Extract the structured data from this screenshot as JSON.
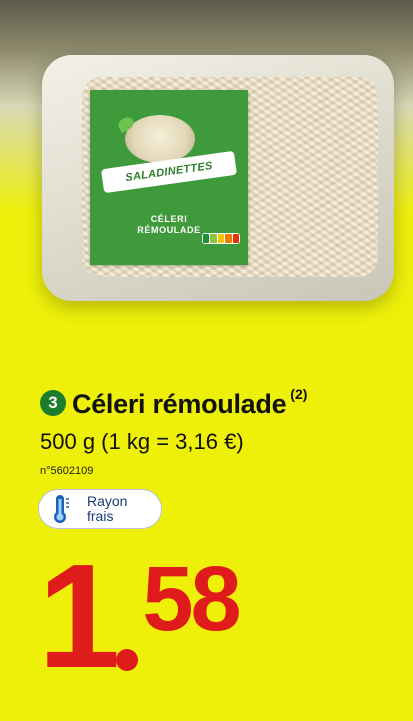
{
  "product": {
    "number": "3",
    "name": "Céleri rémoulade",
    "footnote": "(2)",
    "weight": "500 g (1 kg = 3,16 €)",
    "ref": "n°5602109"
  },
  "badge": {
    "line1": "Rayon",
    "line2": "frais",
    "icon": "thermometer-icon"
  },
  "package": {
    "brand": "SALADINETTES",
    "label_line1": "CÉLERI",
    "label_line2": "RÉMOULADE"
  },
  "price": {
    "integer": "1",
    "decimals": "58"
  },
  "colors": {
    "background": "#eef00a",
    "price": "#e01b1b",
    "number_badge": "#1e7c2d",
    "label_green": "#3e9a3a"
  }
}
